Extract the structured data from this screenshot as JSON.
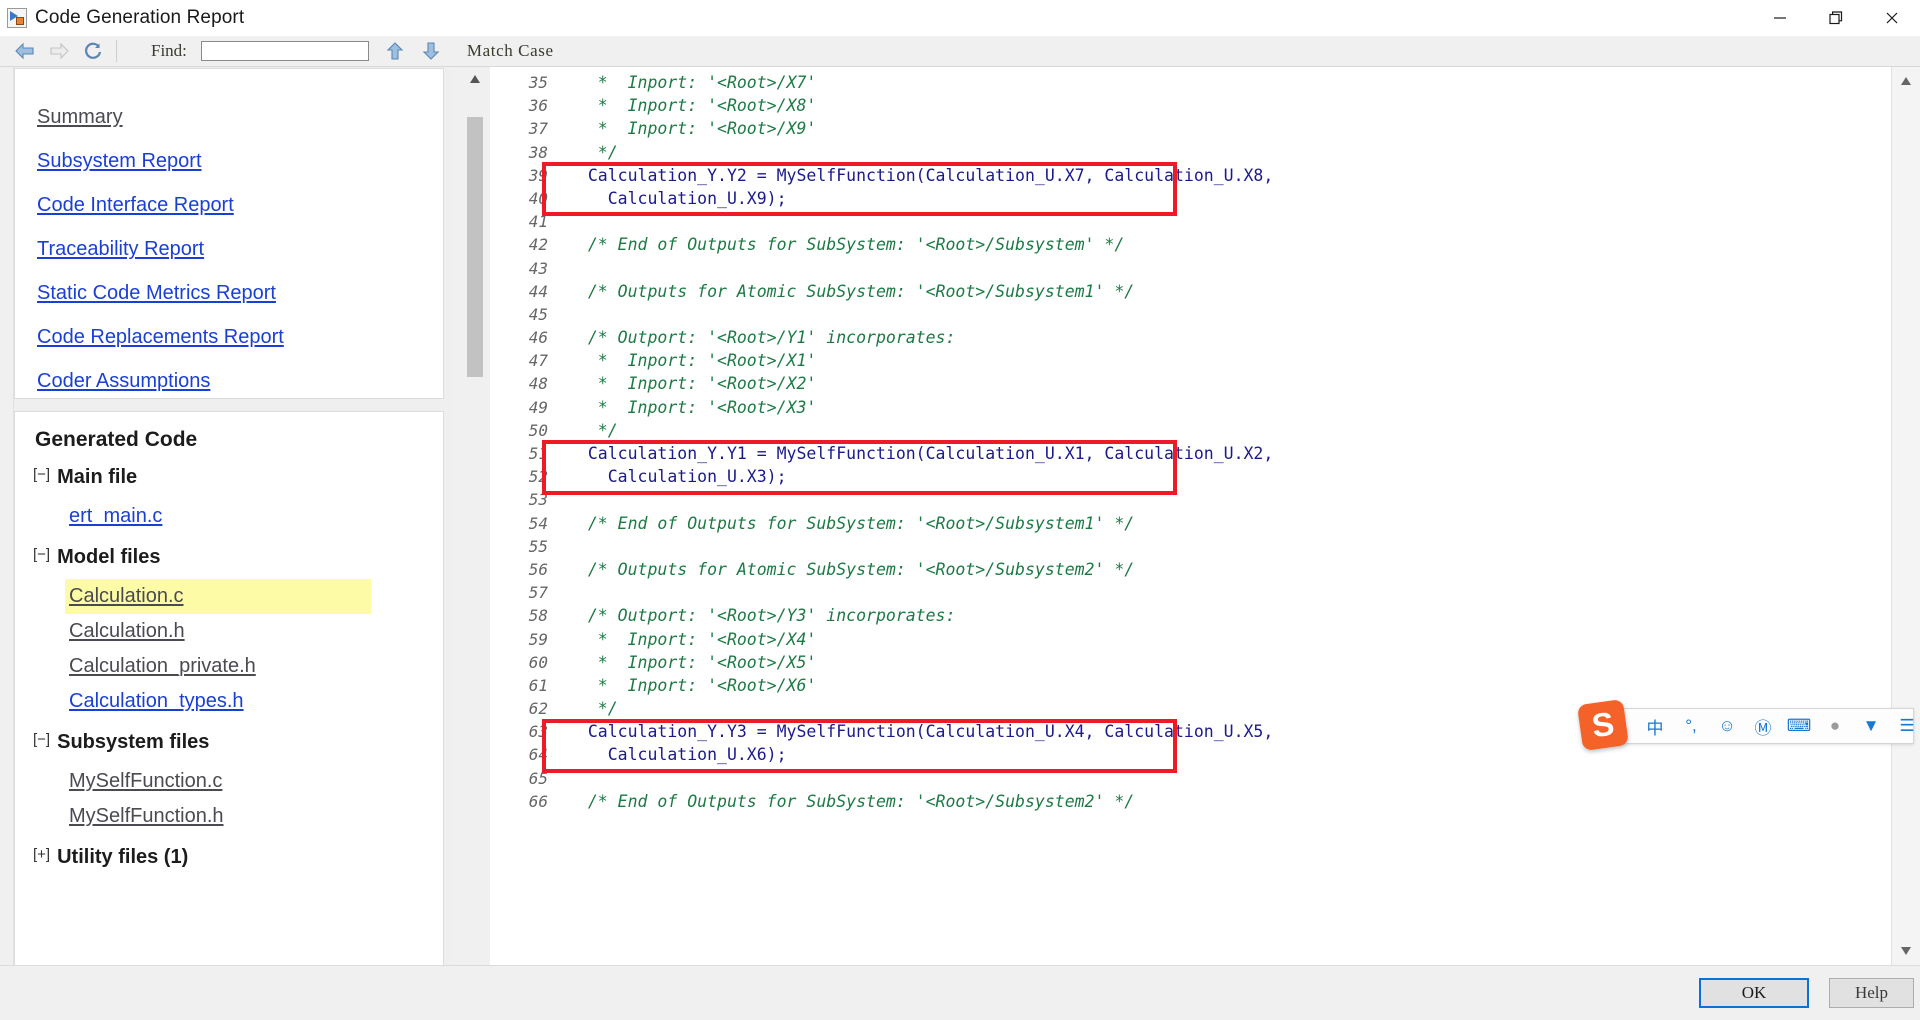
{
  "window": {
    "title": "Code Generation Report",
    "icon": "report-icon",
    "controls": {
      "minimize": "minimize-icon",
      "restore": "restore-icon",
      "close": "close-icon"
    }
  },
  "toolbar": {
    "back": "back-arrow-icon",
    "forward": "forward-arrow-icon",
    "refresh": "refresh-icon",
    "find_label": "Find:",
    "find_value": "",
    "find_placeholder": "",
    "find_prev": "up-arrow-icon",
    "find_next": "down-arrow-icon",
    "match_case": "Match Case"
  },
  "sidebar": {
    "reports": [
      {
        "label": "Summary",
        "visited": true
      },
      {
        "label": "Subsystem Report",
        "visited": false
      },
      {
        "label": "Code Interface Report",
        "visited": false
      },
      {
        "label": "Traceability Report",
        "visited": false
      },
      {
        "label": "Static Code Metrics Report",
        "visited": false
      },
      {
        "label": "Code Replacements Report",
        "visited": false
      },
      {
        "label": "Coder Assumptions",
        "visited": false
      }
    ],
    "tree_title": "Generated Code",
    "groups": [
      {
        "toggle": "[−]",
        "label": "Main file",
        "files": [
          {
            "name": "ert_main.c",
            "visited": false,
            "highlight": false
          }
        ]
      },
      {
        "toggle": "[−]",
        "label": "Model files",
        "files": [
          {
            "name": "Calculation.c",
            "visited": true,
            "highlight": true
          },
          {
            "name": "Calculation.h",
            "visited": true,
            "highlight": false
          },
          {
            "name": "Calculation_private.h",
            "visited": true,
            "highlight": false
          },
          {
            "name": "Calculation_types.h",
            "visited": false,
            "highlight": false
          }
        ]
      },
      {
        "toggle": "[−]",
        "label": "Subsystem files",
        "files": [
          {
            "name": "MySelfFunction.c",
            "visited": true,
            "highlight": false
          },
          {
            "name": "MySelfFunction.h",
            "visited": true,
            "highlight": false
          }
        ]
      },
      {
        "toggle": "[+]",
        "label": "Utility files (1)",
        "files": []
      }
    ]
  },
  "code": {
    "first_line_number": 35,
    "lines": [
      {
        "n": 35,
        "text": "   *  Inport: '<Root>/X7'",
        "kind": "comment"
      },
      {
        "n": 36,
        "text": "   *  Inport: '<Root>/X8'",
        "kind": "comment"
      },
      {
        "n": 37,
        "text": "   *  Inport: '<Root>/X9'",
        "kind": "comment"
      },
      {
        "n": 38,
        "text": "   */",
        "kind": "comment"
      },
      {
        "n": 39,
        "text": "  Calculation_Y.Y2 = MySelfFunction(Calculation_U.X7, Calculation_U.X8,",
        "kind": "code"
      },
      {
        "n": 40,
        "text": "    Calculation_U.X9);",
        "kind": "code"
      },
      {
        "n": 41,
        "text": "",
        "kind": "code"
      },
      {
        "n": 42,
        "text": "  /* End of Outputs for SubSystem: '<Root>/Subsystem' */",
        "kind": "comment"
      },
      {
        "n": 43,
        "text": "",
        "kind": "code"
      },
      {
        "n": 44,
        "text": "  /* Outputs for Atomic SubSystem: '<Root>/Subsystem1' */",
        "kind": "comment"
      },
      {
        "n": 45,
        "text": "",
        "kind": "code"
      },
      {
        "n": 46,
        "text": "  /* Outport: '<Root>/Y1' incorporates:",
        "kind": "comment"
      },
      {
        "n": 47,
        "text": "   *  Inport: '<Root>/X1'",
        "kind": "comment"
      },
      {
        "n": 48,
        "text": "   *  Inport: '<Root>/X2'",
        "kind": "comment"
      },
      {
        "n": 49,
        "text": "   *  Inport: '<Root>/X3'",
        "kind": "comment"
      },
      {
        "n": 50,
        "text": "   */",
        "kind": "comment"
      },
      {
        "n": 51,
        "text": "  Calculation_Y.Y1 = MySelfFunction(Calculation_U.X1, Calculation_U.X2,",
        "kind": "code"
      },
      {
        "n": 52,
        "text": "    Calculation_U.X3);",
        "kind": "code"
      },
      {
        "n": 53,
        "text": "",
        "kind": "code"
      },
      {
        "n": 54,
        "text": "  /* End of Outputs for SubSystem: '<Root>/Subsystem1' */",
        "kind": "comment"
      },
      {
        "n": 55,
        "text": "",
        "kind": "code"
      },
      {
        "n": 56,
        "text": "  /* Outputs for Atomic SubSystem: '<Root>/Subsystem2' */",
        "kind": "comment"
      },
      {
        "n": 57,
        "text": "",
        "kind": "code"
      },
      {
        "n": 58,
        "text": "  /* Outport: '<Root>/Y3' incorporates:",
        "kind": "comment"
      },
      {
        "n": 59,
        "text": "   *  Inport: '<Root>/X4'",
        "kind": "comment"
      },
      {
        "n": 60,
        "text": "   *  Inport: '<Root>/X5'",
        "kind": "comment"
      },
      {
        "n": 61,
        "text": "   *  Inport: '<Root>/X6'",
        "kind": "comment"
      },
      {
        "n": 62,
        "text": "   */",
        "kind": "comment"
      },
      {
        "n": 63,
        "text": "  Calculation_Y.Y3 = MySelfFunction(Calculation_U.X4, Calculation_U.X5,",
        "kind": "code"
      },
      {
        "n": 64,
        "text": "    Calculation_U.X6);",
        "kind": "code"
      },
      {
        "n": 65,
        "text": "",
        "kind": "code"
      },
      {
        "n": 66,
        "text": "  /* End of Outputs for SubSystem: '<Root>/Subsystem2' */",
        "kind": "comment"
      }
    ],
    "annotations": [
      {
        "name": "highlight-box-y2",
        "lines": [
          39,
          40
        ]
      },
      {
        "name": "highlight-box-y1",
        "lines": [
          51,
          52
        ]
      },
      {
        "name": "highlight-box-y3",
        "lines": [
          63,
          64
        ]
      }
    ]
  },
  "ime": {
    "logo": "sogou-logo",
    "items": [
      {
        "icon": "chinese-mode-icon",
        "glyph": "中"
      },
      {
        "icon": "punctuation-mode-icon",
        "glyph": "°,"
      },
      {
        "icon": "emoji-icon",
        "glyph": "☺"
      },
      {
        "icon": "voice-input-icon",
        "glyph": "Ⓜ"
      },
      {
        "icon": "soft-keyboard-icon",
        "glyph": "⌨"
      },
      {
        "icon": "user-account-icon",
        "glyph": "●"
      },
      {
        "icon": "skin-icon",
        "glyph": "▼"
      },
      {
        "icon": "toolbox-icon",
        "glyph": "☰"
      }
    ]
  },
  "footer": {
    "ok": "OK",
    "help": "Help"
  },
  "colors": {
    "link": "#1a3fd4",
    "visited_link": "#4a4a52",
    "highlight": "#fdfba6",
    "annotation_red": "#ee1b26",
    "code_blue": "#1a1a8c",
    "comment_green": "#1d7a44",
    "accent_blue": "#0a72d4",
    "ime_orange": "#f4622a"
  }
}
